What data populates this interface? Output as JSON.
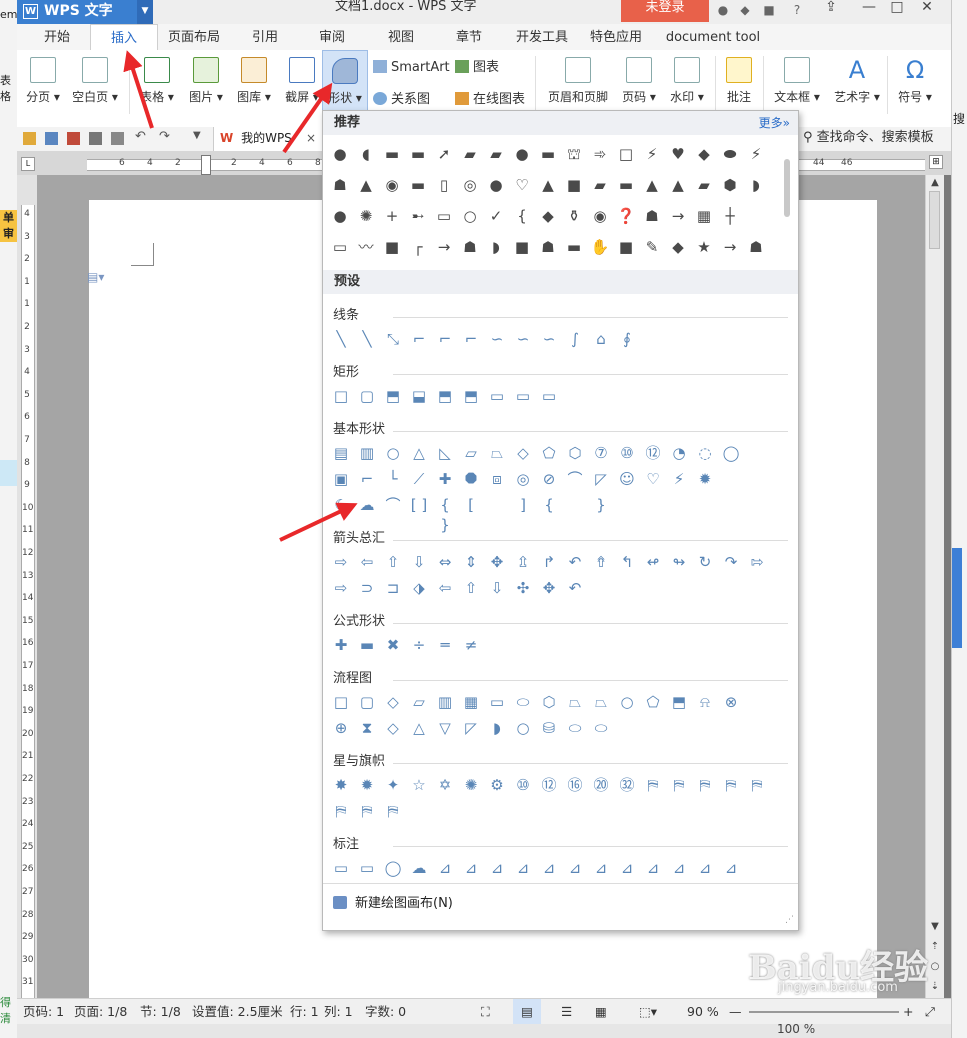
{
  "app": {
    "name": "WPS 文字",
    "document_title": "文档1.docx - WPS 文字",
    "login_label": "未登录"
  },
  "tabs": [
    "开始",
    "插入",
    "页面布局",
    "引用",
    "审阅",
    "视图",
    "章节",
    "开发工具",
    "特色应用",
    "document tool"
  ],
  "active_tab": "插入",
  "ribbon": {
    "page_break": "分页",
    "blank_page": "空白页",
    "table": "表格",
    "picture": "图片",
    "gallery": "图库",
    "screenshot": "截屏",
    "shapes": "形状",
    "smartart": "SmartArt",
    "relation": "关系图",
    "chart": "图表",
    "online_chart": "在线图表",
    "header_footer": "页眉和页脚",
    "page_number": "页码",
    "watermark": "水印",
    "comment": "批注",
    "textbox": "文本框",
    "wordart": "艺术字",
    "symbol": "符号",
    "search_partial": "搜"
  },
  "quickbar": {
    "doc_tab": "我的WPS",
    "find_command": "查找命令、搜索模板"
  },
  "ruler_numbers": [
    "6",
    "4",
    "2",
    "2",
    "4",
    "6",
    "8",
    "44",
    "46"
  ],
  "vruler_numbers": [
    "4",
    "3",
    "2",
    "1",
    "1",
    "2",
    "3",
    "4",
    "5",
    "6",
    "7",
    "8",
    "9",
    "10",
    "11",
    "12",
    "13",
    "14",
    "15",
    "16",
    "17",
    "18",
    "19",
    "20",
    "21",
    "22",
    "23",
    "24",
    "25",
    "26",
    "27",
    "28",
    "29",
    "30",
    "31",
    "32",
    "33"
  ],
  "left_strip": {
    "top_text": "em",
    "row1": "单",
    "row2": "审",
    "table_label": "表格",
    "bottom_text": "得清"
  },
  "shapes_panel": {
    "recommended_header": "推荐",
    "more_link": "更多»",
    "preset_header": "预设",
    "sections": {
      "lines": "线条",
      "rectangles": "矩形",
      "basic": "基本形状",
      "arrows": "箭头总汇",
      "equation": "公式形状",
      "flowchart": "流程图",
      "stars": "星与旗帜",
      "callouts": "标注"
    },
    "new_canvas": "新建绘图画布(N)"
  },
  "statusbar": {
    "page_code": "页码: 1",
    "page": "页面: 1/8",
    "section": "节: 1/8",
    "setting": "设置值: 2.5厘米",
    "row": "行: 1",
    "col": "列: 1",
    "chars": "字数: 0",
    "zoom": "90 %",
    "zoom_bottom": "100 %"
  },
  "watermark": {
    "main": "Baidu经验",
    "sub": "jingyan.baidu.com"
  },
  "colors": {
    "accent": "#2a6cc8",
    "login": "#e8614a",
    "title_logo": "#3a7fd0",
    "arrow": "#e8282a"
  }
}
